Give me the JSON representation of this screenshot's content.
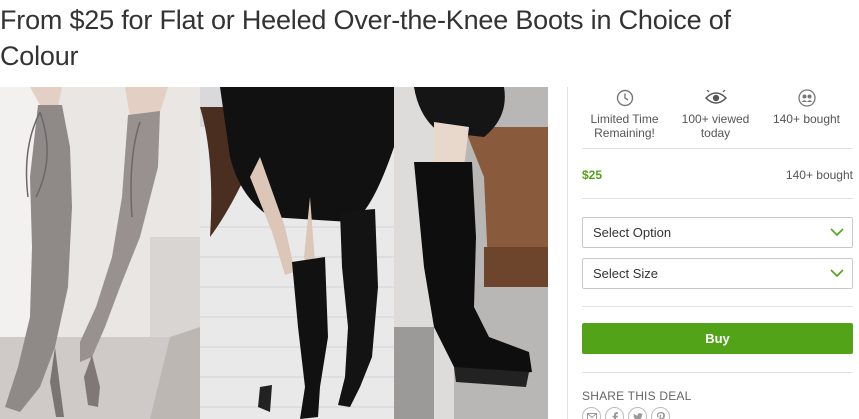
{
  "deal": {
    "title": "From $25 for Flat or Heeled Over-the-Knee Boots in Choice of Colour"
  },
  "gallery": {
    "photos": [
      {
        "description_icon": "image-icon"
      },
      {
        "description_icon": "image-icon"
      },
      {
        "description_icon": "image-icon"
      }
    ]
  },
  "stats": [
    {
      "icon": "clock-icon",
      "label": "Limited Time Remaining!"
    },
    {
      "icon": "eye-icon",
      "label": "100+ viewed today"
    },
    {
      "icon": "people-icon",
      "label": "140+ bought"
    }
  ],
  "price": {
    "value": "$25",
    "bought": "140+ bought"
  },
  "options": {
    "option_select": "Select Option",
    "size_select": "Select Size"
  },
  "buy": {
    "label": "Buy"
  },
  "share": {
    "title": "SHARE THIS DEAL",
    "icons": [
      "email-icon",
      "facebook-icon",
      "twitter-icon",
      "pinterest-icon"
    ]
  },
  "colors": {
    "accent_green": "#53a318",
    "border": "#c9c9c9",
    "chevron": "#53a318"
  }
}
